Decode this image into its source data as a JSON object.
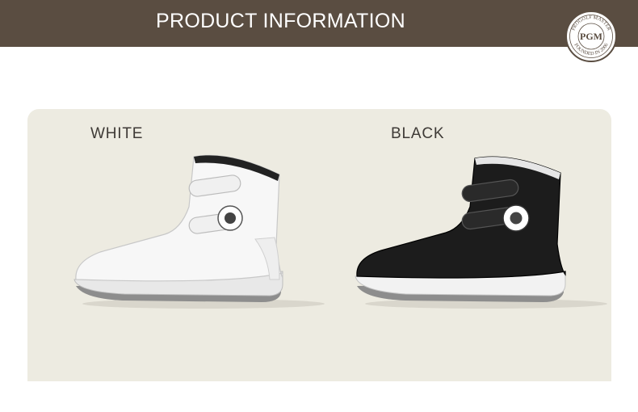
{
  "header": {
    "title": "PRODUCT INFORMATION",
    "background_color": "#5a4d41"
  },
  "logo": {
    "monogram": "PGM",
    "ring_text_top": "PROGOLF MASTER",
    "ring_text_bottom": "FOUNDED IN 2006"
  },
  "variants": [
    {
      "label": "WHITE",
      "boot_color": "#f7f7f7"
    },
    {
      "label": "BLACK",
      "boot_color": "#1c1c1c"
    }
  ],
  "panel": {
    "background_color": "#edebe1"
  }
}
